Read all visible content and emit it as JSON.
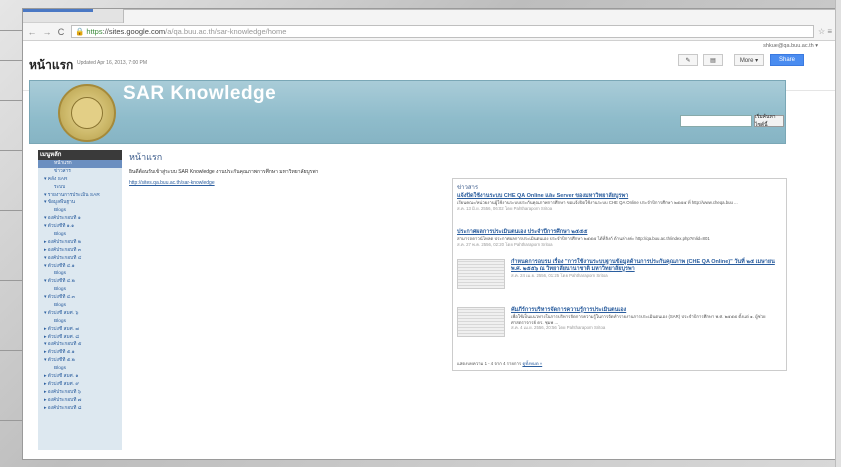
{
  "browser": {
    "url_scheme": "https",
    "url_host": "://sites.google.com",
    "url_path": "/a/qa.buu.ac.th/sar-knowledge/home",
    "lock_icon": "lock-icon",
    "icons": "☆ ≡"
  },
  "header": {
    "user_email": "shkue@qa.buu.ac.th ▾",
    "page_title": "หน้าแรก",
    "updated": "Updated Apr 16, 2013, 7:00 PM",
    "more_label": "More ▾",
    "share_label": "Share",
    "edit_icon": "✎",
    "newpage_icon": "▤"
  },
  "banner": {
    "site_name": "SAR Knowledge",
    "search_button": "เริ่มค้นหาไซต์นี้"
  },
  "sidebar": {
    "heading": "เมนูหลัก",
    "items": [
      {
        "label": "หน้าแรก",
        "active": true
      },
      {
        "label": "ข่าวสาร"
      },
      {
        "label": "▾ คลัง SAR"
      },
      {
        "label": "ระบบ"
      },
      {
        "label": "▾ รายงานการประเมิน SAR"
      },
      {
        "label": "▾ ข้อมูลพื้นฐาน"
      },
      {
        "label": "Blogs"
      },
      {
        "label": "▾ องค์ประกอบที่ ๑"
      },
      {
        "label": "▾ ตัวบ่งชี้ที่ ๑.๑"
      },
      {
        "label": "Blogs"
      },
      {
        "label": "▸ องค์ประกอบที่ ๒"
      },
      {
        "label": "▸ องค์ประกอบที่ ๓"
      },
      {
        "label": "▾ องค์ประกอบที่ ๔"
      },
      {
        "label": "▾ ตัวบ่งชี้ที่ ๔.๑"
      },
      {
        "label": "Blogs"
      },
      {
        "label": "▾ ตัวบ่งชี้ที่ ๔.๒"
      },
      {
        "label": "Blogs"
      },
      {
        "label": "▾ ตัวบ่งชี้ที่ ๔.๓"
      },
      {
        "label": "Blogs"
      },
      {
        "label": "▾ ตัวบ่งชี้ สมศ. ๖"
      },
      {
        "label": "Blogs"
      },
      {
        "label": "▸ ตัวบ่งชี้ สมศ. ๗"
      },
      {
        "label": "▸ ตัวบ่งชี้ สมศ. ๘"
      },
      {
        "label": "▾ องค์ประกอบที่ ๕"
      },
      {
        "label": "▸ ตัวบ่งชี้ที่ ๕.๑"
      },
      {
        "label": "▾ ตัวบ่งชี้ที่ ๕.๒"
      },
      {
        "label": "Blogs"
      },
      {
        "label": "▸ ตัวบ่งชี้ สมศ. ๑"
      },
      {
        "label": "▸ ตัวบ่งชี้ สมศ. ๙"
      },
      {
        "label": "▸ องค์ประกอบที่ ๖"
      },
      {
        "label": "▸ องค์ประกอบที่ ๗"
      },
      {
        "label": "▸ องค์ประกอบที่ ๘"
      }
    ]
  },
  "main": {
    "title": "หน้าแรก",
    "welcome": "ยินดีต้อนรับเข้าสู่ระบบ SAR Knowledge งานประกันคุณภาพการศึกษา มหาวิทยาลัยบูรพา",
    "link": "http://sites.qa.buu.ac.th/sar-knowledge"
  },
  "news": {
    "heading": "ข่าวสาร",
    "items": [
      {
        "title": "แจ้งปิดใช้งานระบบ CHE QA Online และ Server ของมหาวิทยาลัยบูรพา",
        "body": "เรียนคณะ/หน่วยงานผู้ใช้งานระบบประกันคุณภาพการศึกษา ขอแจ้งปิดใช้งานระบบ CHE QA Online ประจำปีการศึกษา ๒๕๕๕ ที่ http://www.cheqa.buu ...",
        "meta": "ส.ค. 13 มิ.ย. 2556, 06:02 โดย Pahtharaporn Sritoa"
      },
      {
        "title": "ประกาศผลการประเมินตนเอง ประจำปีการศึกษา ๒๕๕๕",
        "body": "สามารถดาวน์โหลด ประกาศผลการประเมินตนเอง ประจำปีการศึกษา ๒๕๕๕ ได้ที่ลิงก์ ด้านล่างค่ะ http://qa.buu.ac.th/index.php?mlid=801",
        "meta": "ส.ค. 27 พ.ค. 2556, 02:20 โดย Pahtharaporn Sritoa"
      },
      {
        "title": "กำหนดการอบรม เรื่อง \"การใช้งานระบบฐานข้อมูลด้านการประกันคุณภาพ (CHE QA Online)\" วันที่ ๒๕ เมษายน พ.ศ. ๒๕๕๖ ณ วิทยาลัยนานาชาติ มหาวิทยาลัยบูรพา",
        "body": "",
        "meta": "ส.ค. 24 เม.ย. 2556, 01:25 โดย Pahtharaporn Sritoa"
      },
      {
        "title": "คัมภีร์การบริหารจัดการความรู้การประเมินตนเอง",
        "body": "เพื่อใช้เป็นแนวทางในการบริหารจัดการความรู้ในการจัดทำรายงานการประเมินตนเอง (SAR) ประจำปีการศึกษา พ.ศ. ๒๕๕๕ ตั้งแต่ ๑. ผู้ช่วยศาสตราจารย์ ดร. ชุมพ ...",
        "meta": "ส.ค. 4 เม.ย. 2556, 20:56 โดย Pahtharaporn Sritoa"
      }
    ],
    "footer_text": "แสดงบทความ 1 - 4 จาก 4 รายการ",
    "footer_link": "ดูทั้งหมด »"
  }
}
